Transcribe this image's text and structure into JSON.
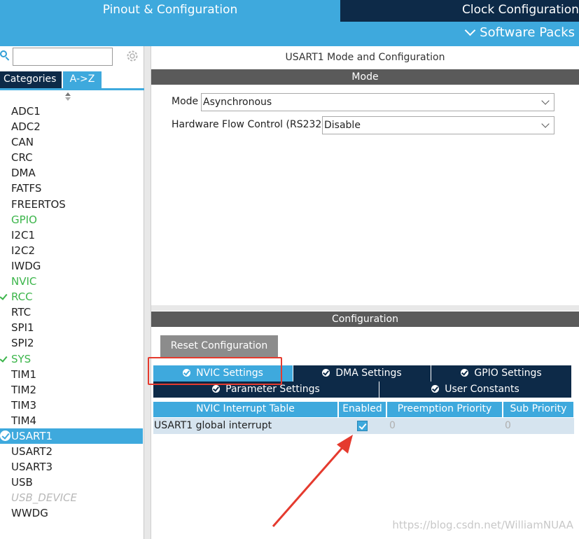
{
  "top_tabs": {
    "pinout": "Pinout & Configuration",
    "clock": "Clock Configuration"
  },
  "software_packs": "Software Packs",
  "left_panel": {
    "search": {
      "value": "",
      "placeholder": ""
    },
    "tabs": {
      "categories": "Categories",
      "az": "A->Z"
    },
    "peripherals": [
      {
        "label": "ADC1",
        "state": "normal"
      },
      {
        "label": "ADC2",
        "state": "normal"
      },
      {
        "label": "CAN",
        "state": "normal"
      },
      {
        "label": "CRC",
        "state": "normal"
      },
      {
        "label": "DMA",
        "state": "normal"
      },
      {
        "label": "FATFS",
        "state": "normal"
      },
      {
        "label": "FREERTOS",
        "state": "normal"
      },
      {
        "label": "GPIO",
        "state": "green"
      },
      {
        "label": "I2C1",
        "state": "normal"
      },
      {
        "label": "I2C2",
        "state": "normal"
      },
      {
        "label": "IWDG",
        "state": "normal"
      },
      {
        "label": "NVIC",
        "state": "green"
      },
      {
        "label": "RCC",
        "state": "green-check"
      },
      {
        "label": "RTC",
        "state": "normal"
      },
      {
        "label": "SPI1",
        "state": "normal"
      },
      {
        "label": "SPI2",
        "state": "normal"
      },
      {
        "label": "SYS",
        "state": "green-check"
      },
      {
        "label": "TIM1",
        "state": "normal"
      },
      {
        "label": "TIM2",
        "state": "normal"
      },
      {
        "label": "TIM3",
        "state": "normal"
      },
      {
        "label": "TIM4",
        "state": "normal"
      },
      {
        "label": "USART1",
        "state": "selected"
      },
      {
        "label": "USART2",
        "state": "normal"
      },
      {
        "label": "USART3",
        "state": "normal"
      },
      {
        "label": "USB",
        "state": "normal"
      },
      {
        "label": "USB_DEVICE",
        "state": "disabled"
      },
      {
        "label": "WWDG",
        "state": "normal"
      }
    ]
  },
  "mode_panel": {
    "title": "USART1 Mode and Configuration",
    "header": "Mode",
    "mode_label": "Mode",
    "mode_value": "Asynchronous",
    "flow_label": "Hardware Flow Control (RS232)",
    "flow_value": "Disable"
  },
  "config_panel": {
    "header": "Configuration",
    "reset_button": "Reset Configuration",
    "tabs": {
      "nvic": "NVIC Settings",
      "dma": "DMA Settings",
      "gpio": "GPIO Settings",
      "parameter": "Parameter Settings",
      "user_constants": "User Constants"
    },
    "table": {
      "headers": [
        "NVIC Interrupt Table",
        "Enabled",
        "Preemption Priority",
        "Sub Priority"
      ],
      "rows": [
        {
          "name": "USART1 global interrupt",
          "enabled": true,
          "preemption": "0",
          "sub": "0"
        }
      ]
    }
  },
  "watermark": "https://blog.csdn.net/WilliamNUAA",
  "colors": {
    "accent": "#3ea9dd",
    "dark_tab": "#0d2a48",
    "header_gray": "#5a5a5a",
    "green": "#3bb54a",
    "annotation_red": "#e53a2e"
  }
}
